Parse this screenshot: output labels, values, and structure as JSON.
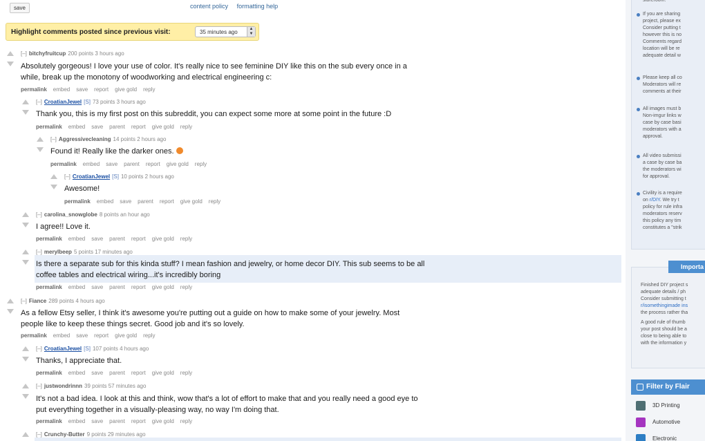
{
  "topbar": {
    "save_label": "save",
    "content_policy": "content policy",
    "formatting_help": "formatting help"
  },
  "highlight": {
    "label": "Highlight comments posted since previous visit:",
    "select_value": "35 minutes ago"
  },
  "comments": [
    {
      "toggle": "[–]",
      "author": "bitchyfruitcup",
      "meta": "200 points 3 hours ago",
      "body": [
        "Absolutely gorgeous! I love your use of color. It's really nice to see feminine DIY like this on the sub every once in a",
        "while, break up the monotony of woodworking and electrical engineering c:"
      ],
      "buttons": [
        "permalink",
        "embed",
        "save",
        "report",
        "give gold",
        "reply"
      ]
    },
    {
      "toggle": "[–]",
      "author": "CroatianJewel",
      "flair": "[S]",
      "meta": "73 points 3 hours ago",
      "body": [
        "Thank you, this is my first post on this subreddit, you can expect some more at some point in the future :D"
      ],
      "buttons": [
        "permalink",
        "embed",
        "save",
        "parent",
        "report",
        "give gold",
        "reply"
      ]
    },
    {
      "toggle": "[–]",
      "author": "Aggressivecleaning",
      "meta": "14 points 2 hours ago",
      "body": [
        "Found it! Really like the darker ones."
      ],
      "buttons": [
        "permalink",
        "embed",
        "save",
        "parent",
        "report",
        "give gold",
        "reply"
      ]
    },
    {
      "toggle": "[–]",
      "author": "CroatianJewel",
      "flair": "[S]",
      "meta": "10 points 2 hours ago",
      "body": [
        "Awesome!"
      ],
      "buttons": [
        "permalink",
        "embed",
        "save",
        "parent",
        "report",
        "give gold",
        "reply"
      ]
    },
    {
      "toggle": "[–]",
      "author": "carolina_snowglobe",
      "meta": "8 points an hour ago",
      "body": [
        "I agree!! Love it."
      ],
      "buttons": [
        "permalink",
        "embed",
        "save",
        "parent",
        "report",
        "give gold",
        "reply"
      ]
    },
    {
      "toggle": "[–]",
      "author": "merylbeep",
      "meta": "5 points 17 minutes ago",
      "body": [
        "Is there a separate sub for this kinda stuff? I mean fashion and jewelry, or home decor DIY. This sub seems to be all",
        "coffee tables and electrical wiring...it's incredibly boring"
      ],
      "buttons": [
        "permalink",
        "embed",
        "save",
        "parent",
        "report",
        "give gold",
        "reply"
      ]
    },
    {
      "toggle": "[–]",
      "author": "Fiance",
      "meta": "289 points 4 hours ago",
      "body": [
        "As a fellow Etsy seller, I think it's awesome you're putting out a guide on how to make some of your jewelry. Most",
        "people like to keep these things secret. Good job and it's so lovely."
      ],
      "buttons": [
        "permalink",
        "embed",
        "save",
        "report",
        "give gold",
        "reply"
      ]
    },
    {
      "toggle": "[–]",
      "author": "CroatianJewel",
      "flair": "[S]",
      "meta": "107 points 4 hours ago",
      "body": [
        "Thanks, I appreciate that."
      ],
      "buttons": [
        "permalink",
        "embed",
        "save",
        "parent",
        "report",
        "give gold",
        "reply"
      ]
    },
    {
      "toggle": "[–]",
      "author": "justwondrinnn",
      "meta": "39 points 57 minutes ago",
      "body": [
        "It's not a bad idea. I look at this and think, wow that's a lot of effort to make that and you really need a good eye to",
        "put everything together in a visually-pleasing way, no way I'm doing that."
      ],
      "buttons": [
        "permalink",
        "embed",
        "save",
        "parent",
        "report",
        "give gold",
        "reply"
      ]
    },
    {
      "toggle": "[–]",
      "author": "Crunchy-Butter",
      "meta": "9 points 29 minutes ago",
      "body": [],
      "buttons": []
    }
  ],
  "sidebar": {
    "rules": [
      [
        "storeroom."
      ],
      [
        "If you are sharing",
        "project, please ex",
        "Consider putting t",
        "however this is no",
        "Comments regard",
        "location will be re",
        "adequate detail w"
      ],
      [
        "Please keep all co",
        "Moderators will re",
        "comments at their"
      ],
      [
        "All images must b",
        "Non-imgur links w",
        "case by case basi",
        "moderators with a",
        "approval."
      ],
      [
        "All video submissi",
        "a case by case ba",
        "the moderators wi",
        "for approval."
      ],
      [
        "Civility is a require",
        "on r/DIY. We try t",
        "policy for rule infra",
        "moderators reserv",
        "this policy any tim",
        "constitutes a \"strik"
      ]
    ],
    "important_label": "Importa",
    "important_lines": [
      "Finished DIY project s",
      "adequate details / ph",
      "Consider submitting t",
      "r/isomethingimade ins",
      "the process rather tha",
      "",
      "A good rule of thumb",
      "your post should be a",
      "close to being able to",
      "with the information y"
    ],
    "flair_header": "Filter by Flair",
    "flair_items": [
      {
        "label": "3D Printing",
        "color": "#4f6f73"
      },
      {
        "label": "Automotive",
        "color": "#a535c0"
      },
      {
        "label": "Electronic",
        "color": "#2d7ec4"
      }
    ]
  }
}
